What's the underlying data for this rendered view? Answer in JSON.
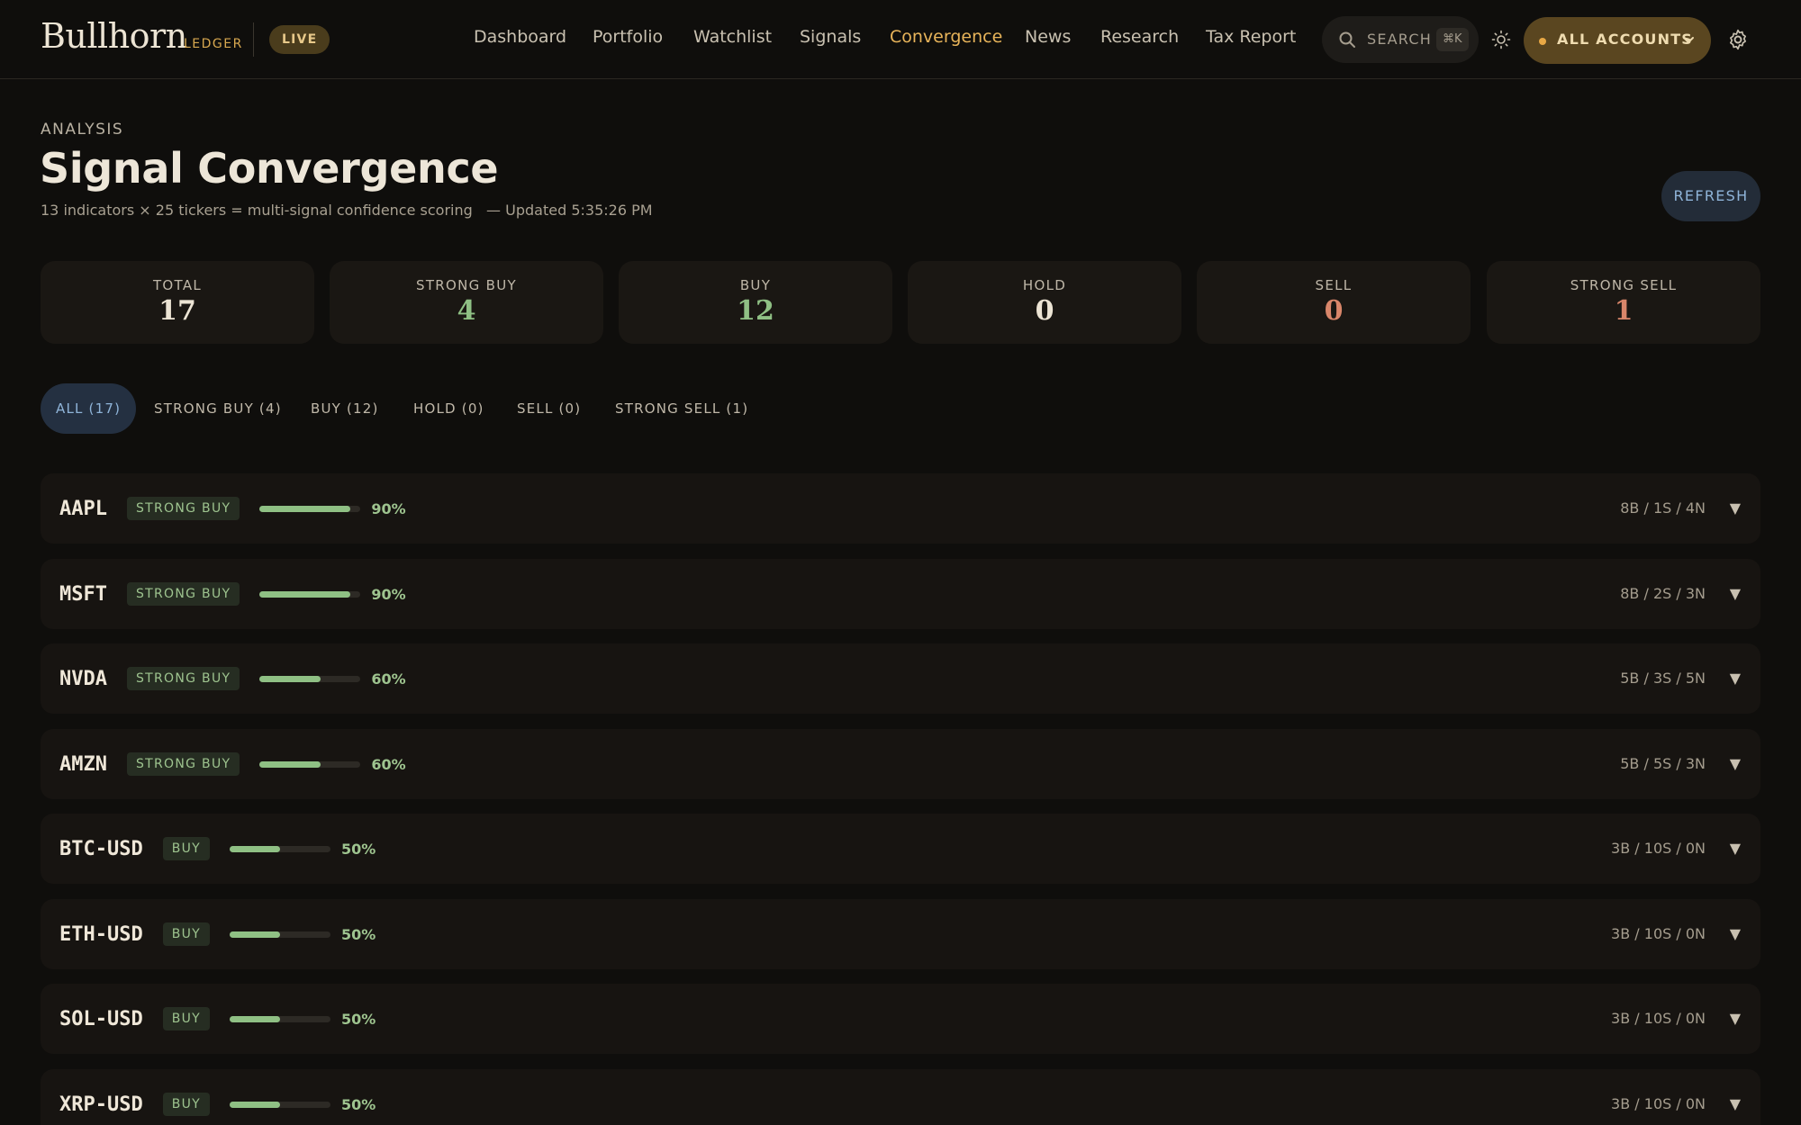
{
  "nav": {
    "brand": "Bullhorn",
    "brand_sub": "LEDGER",
    "live_badge": "LIVE",
    "links": [
      "Dashboard",
      "Portfolio",
      "Watchlist",
      "Signals",
      "Convergence",
      "News",
      "Research",
      "Tax Report"
    ],
    "active_link": "Convergence",
    "search_label": "SEARCH",
    "search_shortcut": "⌘K",
    "accounts_label": "ALL ACCOUNTS",
    "theme_icon": "sun-icon",
    "settings_icon": "gear-icon"
  },
  "header": {
    "eyebrow": "ANALYSIS",
    "title": "Signal Convergence",
    "subtitle": "13 indicators × 25 tickers = multi-signal confidence scoring",
    "updated": "— Updated 5:35:26 PM",
    "refresh_label": "REFRESH"
  },
  "stats": [
    {
      "label": "TOTAL",
      "value": "17",
      "color": "#ece4d4"
    },
    {
      "label": "STRONG BUY",
      "value": "4",
      "color": "#8fc084"
    },
    {
      "label": "BUY",
      "value": "12",
      "color": "#8fc084"
    },
    {
      "label": "HOLD",
      "value": "0",
      "color": "#ece4d4"
    },
    {
      "label": "SELL",
      "value": "0",
      "color": "#d9866a"
    },
    {
      "label": "STRONG SELL",
      "value": "1",
      "color": "#d9866a"
    }
  ],
  "filters": [
    {
      "label": "ALL (17)",
      "active": true
    },
    {
      "label": "STRONG BUY (4)",
      "active": false
    },
    {
      "label": "BUY (12)",
      "active": false
    },
    {
      "label": "HOLD (0)",
      "active": false
    },
    {
      "label": "SELL (0)",
      "active": false
    },
    {
      "label": "STRONG SELL (1)",
      "active": false
    }
  ],
  "rows": [
    {
      "ticker": "AAPL",
      "signal": "STRONG BUY",
      "confidence": 0.9,
      "pct": "90%",
      "counts": "8B / 1S / 4N"
    },
    {
      "ticker": "MSFT",
      "signal": "STRONG BUY",
      "confidence": 0.9,
      "pct": "90%",
      "counts": "8B / 2S / 3N"
    },
    {
      "ticker": "NVDA",
      "signal": "STRONG BUY",
      "confidence": 0.6,
      "pct": "60%",
      "counts": "5B / 3S / 5N"
    },
    {
      "ticker": "AMZN",
      "signal": "STRONG BUY",
      "confidence": 0.6,
      "pct": "60%",
      "counts": "5B / 5S / 3N"
    },
    {
      "ticker": "BTC-USD",
      "signal": "BUY",
      "confidence": 0.5,
      "pct": "50%",
      "counts": "3B / 10S / 0N"
    },
    {
      "ticker": "ETH-USD",
      "signal": "BUY",
      "confidence": 0.5,
      "pct": "50%",
      "counts": "3B / 10S / 0N"
    },
    {
      "ticker": "SOL-USD",
      "signal": "BUY",
      "confidence": 0.5,
      "pct": "50%",
      "counts": "3B / 10S / 0N"
    },
    {
      "ticker": "XRP-USD",
      "signal": "BUY",
      "confidence": 0.5,
      "pct": "50%",
      "counts": "3B / 10S / 0N"
    }
  ],
  "expand_glyph": "▼",
  "colors": {
    "accent": "#e8b45a",
    "buy": "#8fc084",
    "sell": "#d9866a",
    "info": "#8fb4d8"
  }
}
